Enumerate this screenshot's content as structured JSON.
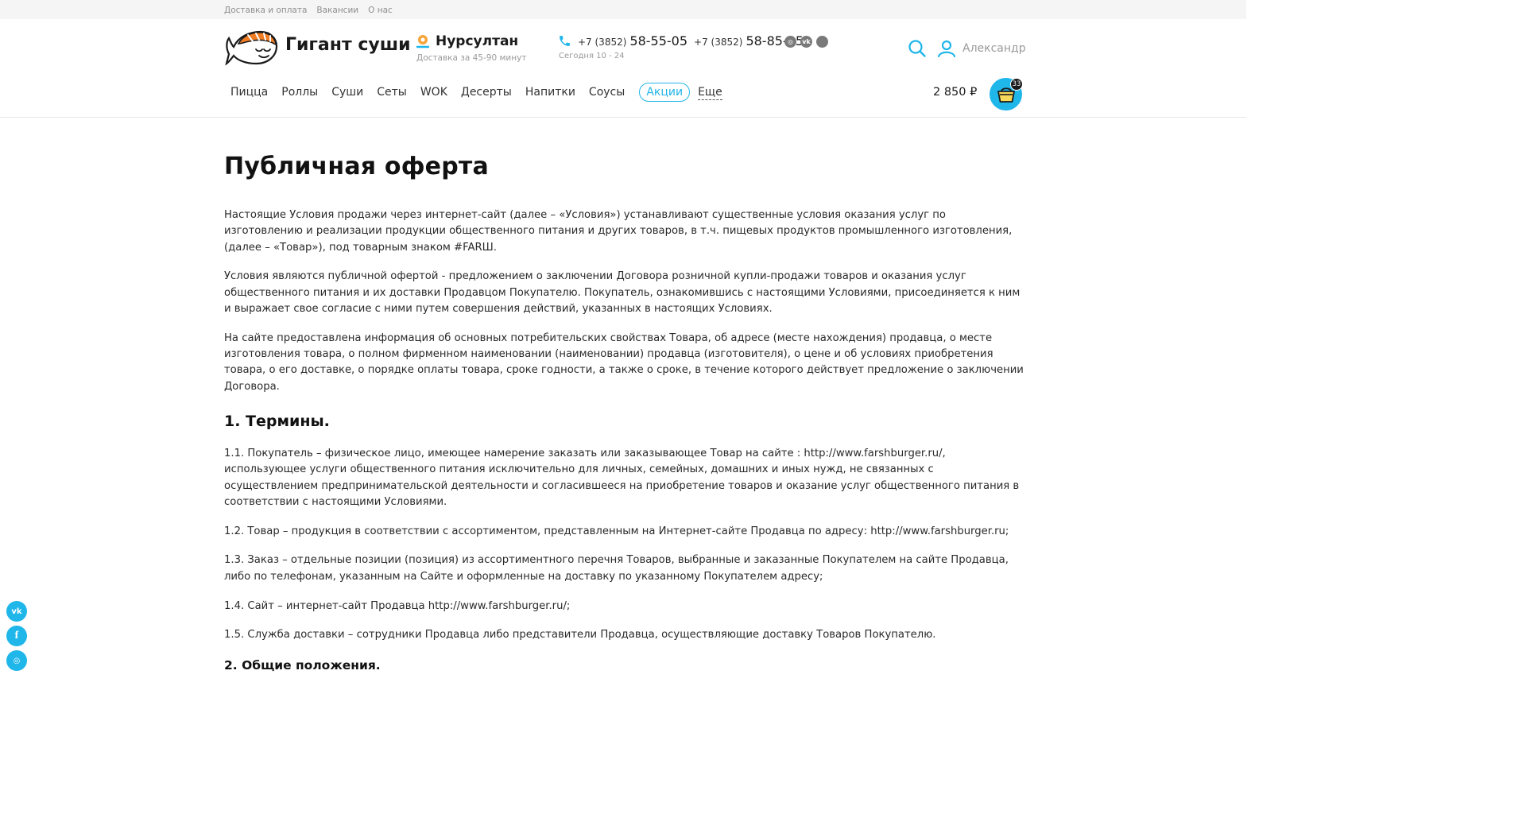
{
  "topbar": {
    "links": [
      "Доставка и оплата",
      "Вакансии",
      "О нас"
    ]
  },
  "header": {
    "brand": "Гигант суши",
    "city": "Нурсултан",
    "delivery_time": "Доставка за 45-90 минут",
    "phones": [
      {
        "prefix": "+7 (3852)",
        "number": "58-55-05"
      },
      {
        "prefix": "+7 (3852)",
        "number": "58-85-05"
      }
    ],
    "hours": "Сегодня 10 - 24",
    "user_name": "Александр",
    "top_socials": [
      "instagram-icon",
      "vk-icon",
      "circle-icon"
    ]
  },
  "nav": {
    "items": [
      "Пицца",
      "Роллы",
      "Суши",
      "Сеты",
      "WOK",
      "Десерты",
      "Напитки",
      "Соусы"
    ],
    "promo": "Акции",
    "more": "Еще"
  },
  "cart": {
    "total": "2 850 ₽",
    "count": "33"
  },
  "page": {
    "title": "Публичная оферта",
    "intro": [
      "Настоящие Условия продажи через интернет-сайт (далее – «Условия») устанавливают существенные условия оказания услуг по изготовлению и реализации продукции общественного питания и других товаров, в т.ч. пищевых продуктов промышленного изготовления, (далее – «Товар»), под товарным знаком #FARШ.",
      "Условия являются публичной офертой - предложением о заключении Договора розничной купли-продажи товаров и оказания услуг общественного питания и их доставки Продавцом Покупателю. Покупатель, ознакомившись с настоящими Условиями, присоединяется к ним и выражает свое согласие с ними путем совершения действий, указанных в настоящих Условиях.",
      "На сайте предоставлена информация об основных потребительских свойствах Товара, об адресе (месте нахождения) продавца, о месте изготовления товара, о полном фирменном наименовании (наименовании) продавца (изготовителя), о цене и об условиях приобретения товара, о его доставке, о порядке оплаты товара, сроке годности, а также о сроке, в течение которого действует предложение о заключении Договора."
    ],
    "section1_title": "1. Термины.",
    "terms": [
      "1.1. Покупатель – физическое лицо, имеющее намерение заказать или заказывающее Товар на сайте : http://www.farshburger.ru/, использующее услуги общественного питания исключительно для личных, семейных, домашних и иных нужд, не связанных с осуществлением предпринимательской деятельности и согласившееся на приобретение товаров и оказание услуг общественного питания в соответствии с настоящими Условиями.",
      "1.2. Товар – продукция в соответствии с ассортиментом, представленным на Интернет-сайте Продавца по адресу: http://www.farshburger.ru;",
      "1.3. Заказ – отдельные позиции (позиция) из ассортиментного перечня Товаров, выбранные и заказанные Покупателем на сайте Продавца, либо по телефонам, указанным на Сайте и оформленные на доставку по указанному Покупателем адресу;",
      "1.4. Сайт – интернет-сайт Продавца http://www.farshburger.ru/;",
      "1.5. Служба доставки – сотрудники Продавца либо представители Продавца, осуществляющие доставку Товаров Покупателю."
    ],
    "section2_title": "2. Общие положения."
  },
  "float_socials": [
    "vk-icon",
    "facebook-icon",
    "instagram-icon"
  ],
  "colors": {
    "accent": "#1fb6ea",
    "logo_orange": "#f07d23"
  }
}
